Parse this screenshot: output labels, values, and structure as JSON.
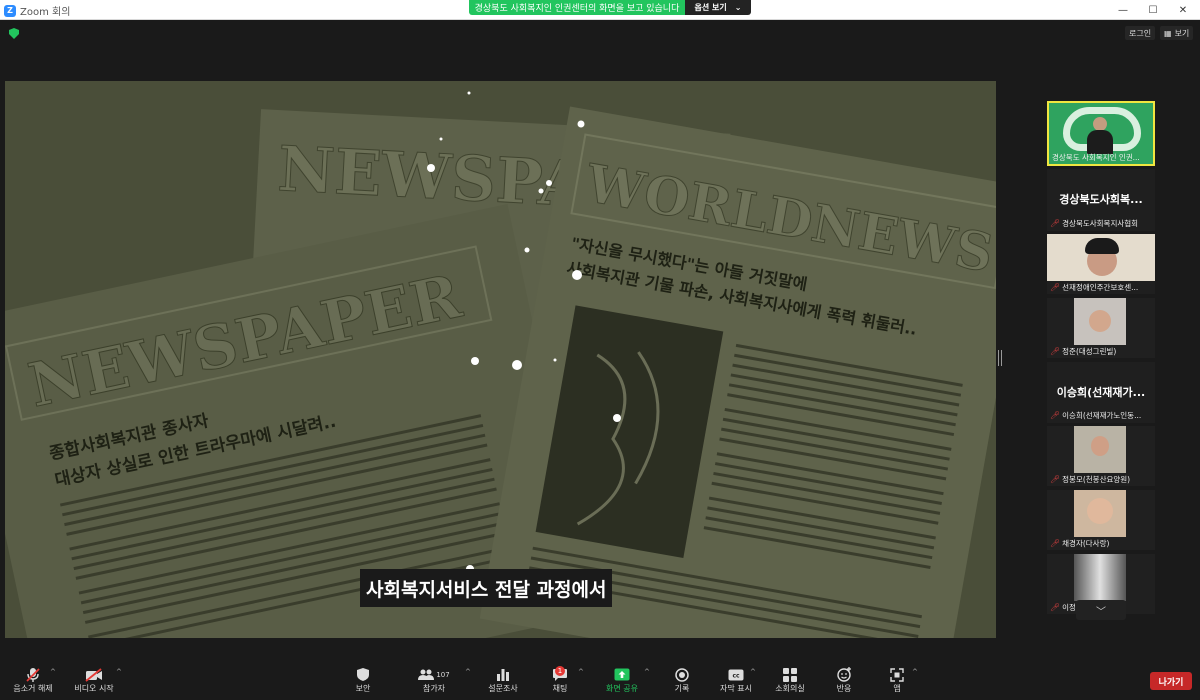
{
  "window": {
    "app_title": "Zoom 회의",
    "minimize": "—",
    "maximize": "☐",
    "close": "✕"
  },
  "share_banner": {
    "text": "경상북도 사회복지인 인권센터의 화면을 보고 있습니다",
    "options_label": "옵션 보기"
  },
  "top_right": {
    "login_label": "로그인",
    "view_label": "보기"
  },
  "shared_screen": {
    "headline_left": "NEWSPAPER",
    "headline_back": "NEWSPA",
    "headline_right": "WORLDNEWS",
    "article_left_1": "종합사회복지관 종사자",
    "article_left_2": "대상자 상실로 인한 트라우마에 시달려..",
    "article_right_1": "\"자신을 무시했다\"는 아들 거짓말에",
    "article_right_2": "사회복지관 기물 파손, 사회복지사에게 폭력 휘둘러..",
    "subtitle": "사회복지서비스 전달 과정에서"
  },
  "participants": [
    {
      "name": "경상북도 사회복지인 인권...",
      "type": "video"
    },
    {
      "name": "경상북도사회복...",
      "type": "bigname"
    },
    {
      "name": "경상북도사회복지사협회",
      "type": "label"
    },
    {
      "name": "선재정애인주간보호센...",
      "type": "video"
    },
    {
      "name": "정준(대성그린빌)",
      "type": "video"
    },
    {
      "name": "이승희(선재재가...",
      "type": "bigname"
    },
    {
      "name": "이승희(선재재가노인동...",
      "type": "label"
    },
    {
      "name": "정봉모(천봉산요양원)",
      "type": "video"
    },
    {
      "name": "채경자(다사랑)",
      "type": "video"
    },
    {
      "name": "이정미 향기마을",
      "type": "video"
    }
  ],
  "toolbar": {
    "unmute_label": "음소거 해제",
    "video_label": "비디오 시작",
    "security_label": "보안",
    "participants_label": "참가자",
    "participants_count": "107",
    "poll_label": "설문조사",
    "chat_label": "채팅",
    "chat_badge": "1",
    "share_label": "화면 공유",
    "record_label": "기록",
    "cc_label": "자막 표시",
    "breakout_label": "소회의실",
    "reactions_label": "반응",
    "apps_label": "앱",
    "leave_label": "나가기"
  },
  "colors": {
    "accent": "#2d8cff",
    "share_green": "#22c55e",
    "leave_red": "#c62828",
    "speaker_border": "#f0e640"
  }
}
